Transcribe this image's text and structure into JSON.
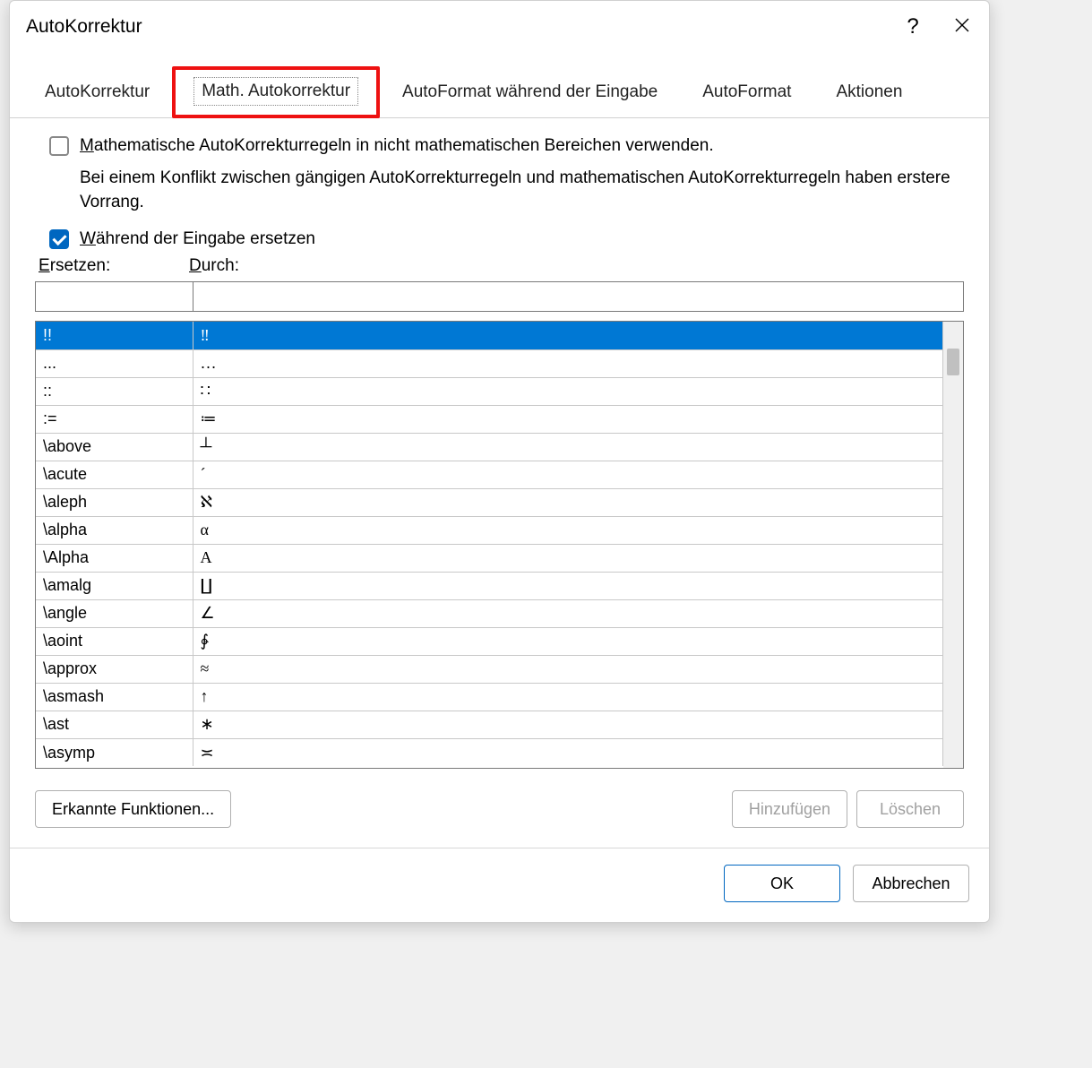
{
  "window": {
    "title": "AutoKorrektur"
  },
  "tabs": {
    "items": [
      {
        "label": "AutoKorrektur"
      },
      {
        "label": "Math. Autokorrektur"
      },
      {
        "label": "AutoFormat während der Eingabe"
      },
      {
        "label": "AutoFormat"
      },
      {
        "label": "Aktionen"
      }
    ],
    "active_index": 1,
    "highlighted_index": 1
  },
  "options": {
    "use_in_non_math_label": "Mathematische AutoKorrekturregeln in nicht mathematischen Bereichen verwenden.",
    "use_in_non_math_checked": false,
    "conflict_note": "Bei einem Konflikt zwischen gängigen AutoKorrekturregeln und mathematischen AutoKorrekturregeln haben erstere Vorrang.",
    "replace_while_typing_label": "Während der Eingabe ersetzen",
    "replace_while_typing_checked": true
  },
  "fields": {
    "replace_label": "Ersetzen:",
    "with_label": "Durch:",
    "replace_value": "",
    "with_value": ""
  },
  "table": {
    "selected_index": 0,
    "rows": [
      {
        "replace": "!!",
        "with": "‼"
      },
      {
        "replace": "...",
        "with": "…"
      },
      {
        "replace": "::",
        "with": "∷"
      },
      {
        "replace": ":=",
        "with": "≔"
      },
      {
        "replace": "\\above",
        "with": "┴"
      },
      {
        "replace": "\\acute",
        "with": "´"
      },
      {
        "replace": "\\aleph",
        "with": "ℵ"
      },
      {
        "replace": "\\alpha",
        "with": "α"
      },
      {
        "replace": "\\Alpha",
        "with": "Α"
      },
      {
        "replace": "\\amalg",
        "with": "∐"
      },
      {
        "replace": "\\angle",
        "with": "∠"
      },
      {
        "replace": "\\aoint",
        "with": "∳"
      },
      {
        "replace": "\\approx",
        "with": "≈"
      },
      {
        "replace": "\\asmash",
        "with": "↑"
      },
      {
        "replace": "\\ast",
        "with": "∗"
      },
      {
        "replace": "\\asymp",
        "with": "≍"
      }
    ]
  },
  "buttons": {
    "recognized_functions": "Erkannte Funktionen...",
    "add": "Hinzufügen",
    "delete": "Löschen",
    "ok": "OK",
    "cancel": "Abbrechen"
  }
}
